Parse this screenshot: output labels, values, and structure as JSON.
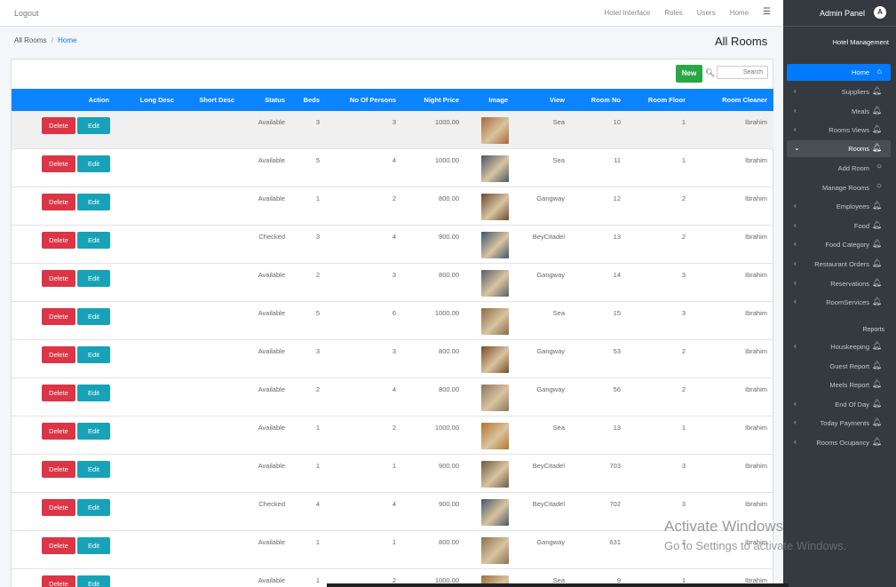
{
  "topbar": {
    "logout": "Logout",
    "nav": [
      "Hotel Interface",
      "Roles",
      "Users",
      "Home"
    ],
    "menu_icon": "hamburger-icon"
  },
  "breadcrumb": {
    "parent": "All Rooms",
    "separator": "/",
    "current": "Home"
  },
  "page_title": "All Rooms",
  "toolbar": {
    "new_label": "New",
    "search_placeholder": "Search",
    "search_icon": "magnifier-icon"
  },
  "table": {
    "headers": {
      "action": "Action",
      "long_desc": "Long Desc",
      "short_desc": "Short Desc",
      "status": "Status",
      "beds": "Beds",
      "persons": "No Of Persons",
      "price": "Night Price",
      "image": "Image",
      "view": "View",
      "room_no": "Room No",
      "floor": "Room Floor",
      "cleaner": "Room Cleaner"
    },
    "delete_label": "Delete",
    "edit_label": "Edit",
    "rows": [
      {
        "status": "Available",
        "beds": "3",
        "persons": "3",
        "price": "1000.00",
        "view": "Sea",
        "room_no": "10",
        "floor": "1",
        "cleaner": "Ibrahim",
        "thumb": "#a6683a"
      },
      {
        "status": "Available",
        "beds": "5",
        "persons": "4",
        "price": "1000.00",
        "view": "Sea",
        "room_no": "11",
        "floor": "1",
        "cleaner": "Ibrahim",
        "thumb": "#4a5566"
      },
      {
        "status": "Available",
        "beds": "1",
        "persons": "2",
        "price": "800.00",
        "view": "Gangway",
        "room_no": "12",
        "floor": "2",
        "cleaner": "Ibrahim",
        "thumb": "#6b4a33"
      },
      {
        "status": "Checked",
        "beds": "3",
        "persons": "4",
        "price": "900.00",
        "view": "BeyCitadel",
        "room_no": "13",
        "floor": "2",
        "cleaner": "Ibrahim",
        "thumb": "#3f5470"
      },
      {
        "status": "Available",
        "beds": "2",
        "persons": "3",
        "price": "800.00",
        "view": "Gangway",
        "room_no": "14",
        "floor": "3",
        "cleaner": "Ibrahim",
        "thumb": "#5a5f66"
      },
      {
        "status": "Available",
        "beds": "5",
        "persons": "6",
        "price": "1000.00",
        "view": "Sea",
        "room_no": "15",
        "floor": "3",
        "cleaner": "Ibrahim",
        "thumb": "#8a6a45"
      },
      {
        "status": "Available",
        "beds": "3",
        "persons": "3",
        "price": "800.00",
        "view": "Gangway",
        "room_no": "53",
        "floor": "2",
        "cleaner": "Ibrahim",
        "thumb": "#7a4a2a"
      },
      {
        "status": "Available",
        "beds": "2",
        "persons": "4",
        "price": "800.00",
        "view": "Gangway",
        "room_no": "56",
        "floor": "2",
        "cleaner": "Ibrahim",
        "thumb": "#8c7560"
      },
      {
        "status": "Available",
        "beds": "1",
        "persons": "2",
        "price": "1000.00",
        "view": "Sea",
        "room_no": "13",
        "floor": "1",
        "cleaner": "Ibrahim",
        "thumb": "#b5742a"
      },
      {
        "status": "Available",
        "beds": "1",
        "persons": "1",
        "price": "900.00",
        "view": "BeyCitadel",
        "room_no": "703",
        "floor": "3",
        "cleaner": "Ibrahim",
        "thumb": "#6e5a45"
      },
      {
        "status": "Checked",
        "beds": "4",
        "persons": "4",
        "price": "900.00",
        "view": "BeyCitadel",
        "room_no": "702",
        "floor": "3",
        "cleaner": "Ibrahim",
        "thumb": "#44566e"
      },
      {
        "status": "Available",
        "beds": "1",
        "persons": "1",
        "price": "800.00",
        "view": "Gangway",
        "room_no": "631",
        "floor": "2",
        "cleaner": "Ibrahim",
        "thumb": "#8a7055"
      },
      {
        "status": "Available",
        "beds": "1",
        "persons": "2",
        "price": "1000.00",
        "view": "Sea",
        "room_no": "9",
        "floor": "1",
        "cleaner": "Ibrahim",
        "thumb": "#a07040"
      }
    ]
  },
  "sidebar": {
    "title": "Admin Panel",
    "logo_letter": "A",
    "subtitle": "Hotel Management",
    "reports_header": "Reports",
    "items": [
      {
        "label": "Home",
        "icon": "home-icon",
        "chev": "",
        "state": "active"
      },
      {
        "label": "Suppliers",
        "icon": "bell-icon",
        "chev": "‹",
        "state": ""
      },
      {
        "label": "Meals",
        "icon": "bell-icon",
        "chev": "‹",
        "state": ""
      },
      {
        "label": "Rooms Views",
        "icon": "bell-icon",
        "chev": "‹",
        "state": ""
      },
      {
        "label": "Rooms",
        "icon": "bell-icon",
        "chev": "⌄",
        "state": "open"
      },
      {
        "label": "Add Room",
        "icon": "circle-icon",
        "chev": "",
        "state": "sub"
      },
      {
        "label": "Manage Rooms",
        "icon": "circle-icon",
        "chev": "",
        "state": "sub"
      },
      {
        "label": "Employees",
        "icon": "bell-icon",
        "chev": "‹",
        "state": ""
      },
      {
        "label": "Food",
        "icon": "bell-icon",
        "chev": "‹",
        "state": ""
      },
      {
        "label": "Food Category",
        "icon": "bell-icon",
        "chev": "‹",
        "state": ""
      },
      {
        "label": "Restaurant Orders",
        "icon": "bell-icon",
        "chev": "‹",
        "state": ""
      },
      {
        "label": "Reservations",
        "icon": "bell-icon",
        "chev": "‹",
        "state": ""
      },
      {
        "label": "RoomServices",
        "icon": "bell-icon",
        "chev": "‹",
        "state": ""
      }
    ],
    "report_items": [
      {
        "label": "Houskeeping",
        "icon": "bell-icon",
        "chev": "‹"
      },
      {
        "label": "Guest Report",
        "icon": "bell-icon",
        "chev": ""
      },
      {
        "label": "Meels Report",
        "icon": "bell-icon",
        "chev": ""
      },
      {
        "label": "End Of Day",
        "icon": "bell-icon",
        "chev": "‹"
      },
      {
        "label": "Today Payments",
        "icon": "bell-icon",
        "chev": "‹"
      },
      {
        "label": "Rooms Ocupancy",
        "icon": "bell-icon",
        "chev": "‹"
      }
    ]
  },
  "overlay": {
    "activate_title": "Activate Windows",
    "activate_sub": "Go to Settings to activate Windows."
  }
}
